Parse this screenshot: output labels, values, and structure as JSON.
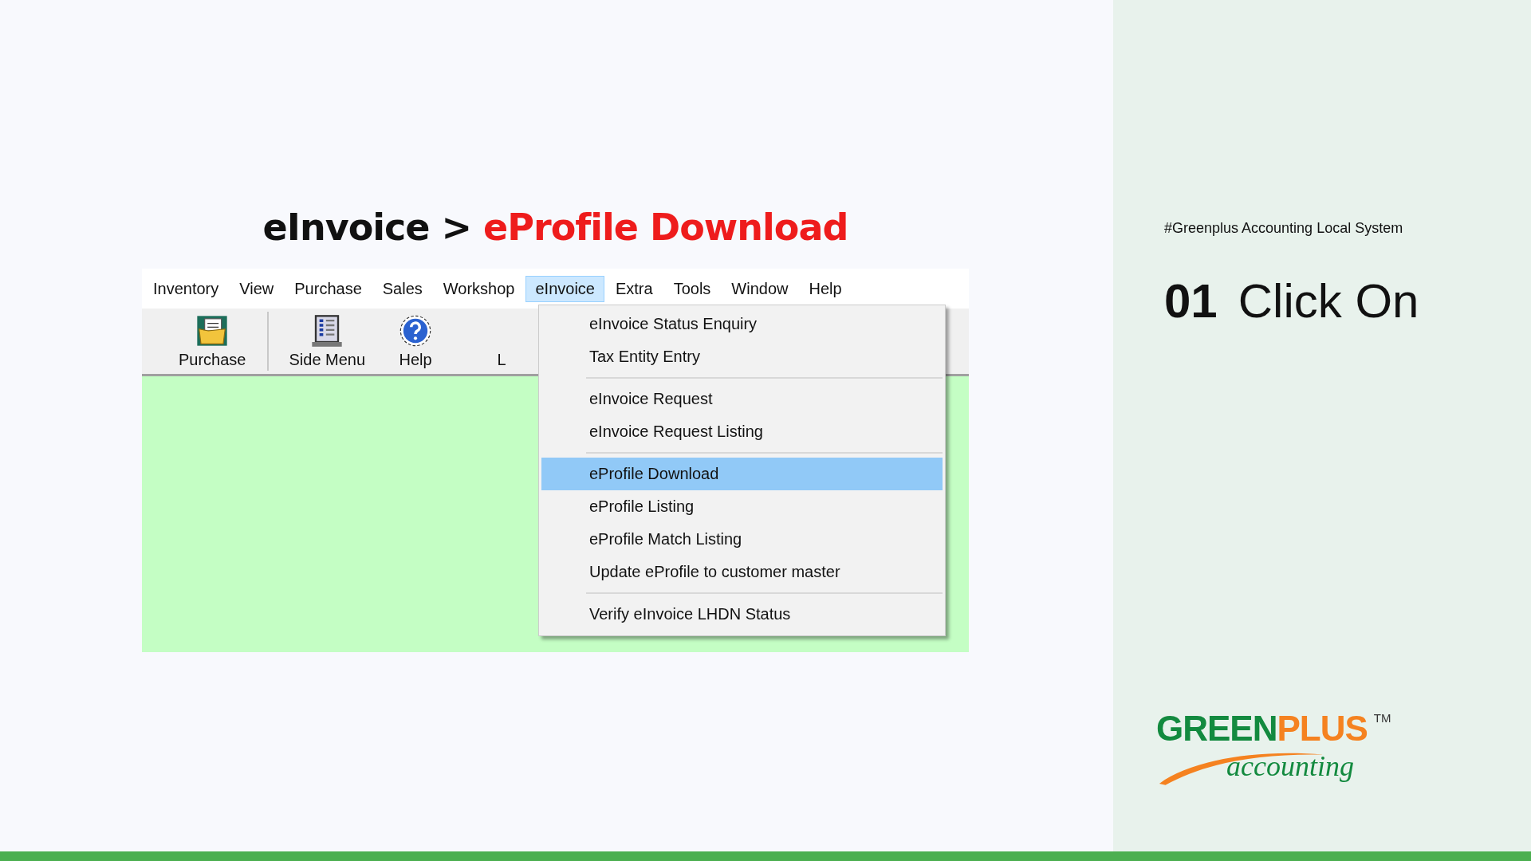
{
  "heading": {
    "path": "eInvoice >",
    "target": "eProfile Download"
  },
  "app": {
    "menu_bar": [
      {
        "label": "Inventory",
        "selected": false
      },
      {
        "label": "View",
        "selected": false
      },
      {
        "label": "Purchase",
        "selected": false
      },
      {
        "label": "Sales",
        "selected": false
      },
      {
        "label": "Workshop",
        "selected": false
      },
      {
        "label": "eInvoice",
        "selected": true
      },
      {
        "label": "Extra",
        "selected": false
      },
      {
        "label": "Tools",
        "selected": false
      },
      {
        "label": "Window",
        "selected": false
      },
      {
        "label": "Help",
        "selected": false
      }
    ],
    "toolbar": [
      {
        "label": "Purchase",
        "kind": "purchase"
      },
      {
        "label": "Side Menu",
        "kind": "side-menu"
      },
      {
        "label": "Help",
        "kind": "help"
      },
      {
        "label": "L",
        "kind": "hidden"
      }
    ],
    "dropdown_groups": [
      [
        {
          "label": "eInvoice Status Enquiry",
          "selected": false
        },
        {
          "label": "Tax Entity Entry",
          "selected": false
        }
      ],
      [
        {
          "label": "eInvoice Request",
          "selected": false
        },
        {
          "label": "eInvoice Request Listing",
          "selected": false
        }
      ],
      [
        {
          "label": "eProfile Download",
          "selected": true
        },
        {
          "label": "eProfile Listing",
          "selected": false
        },
        {
          "label": "eProfile Match Listing",
          "selected": false
        },
        {
          "label": "Update eProfile to customer master",
          "selected": false
        }
      ],
      [
        {
          "label": "Verify eInvoice LHDN Status",
          "selected": false
        }
      ]
    ]
  },
  "side_panel": {
    "tag": "#Greenplus Accounting Local System",
    "step_number": "01",
    "step_title": "Click On",
    "logo": {
      "brand_first": "GREEN",
      "brand_second": "PLUS",
      "trademark": "TM",
      "tagline": "accounting"
    }
  }
}
